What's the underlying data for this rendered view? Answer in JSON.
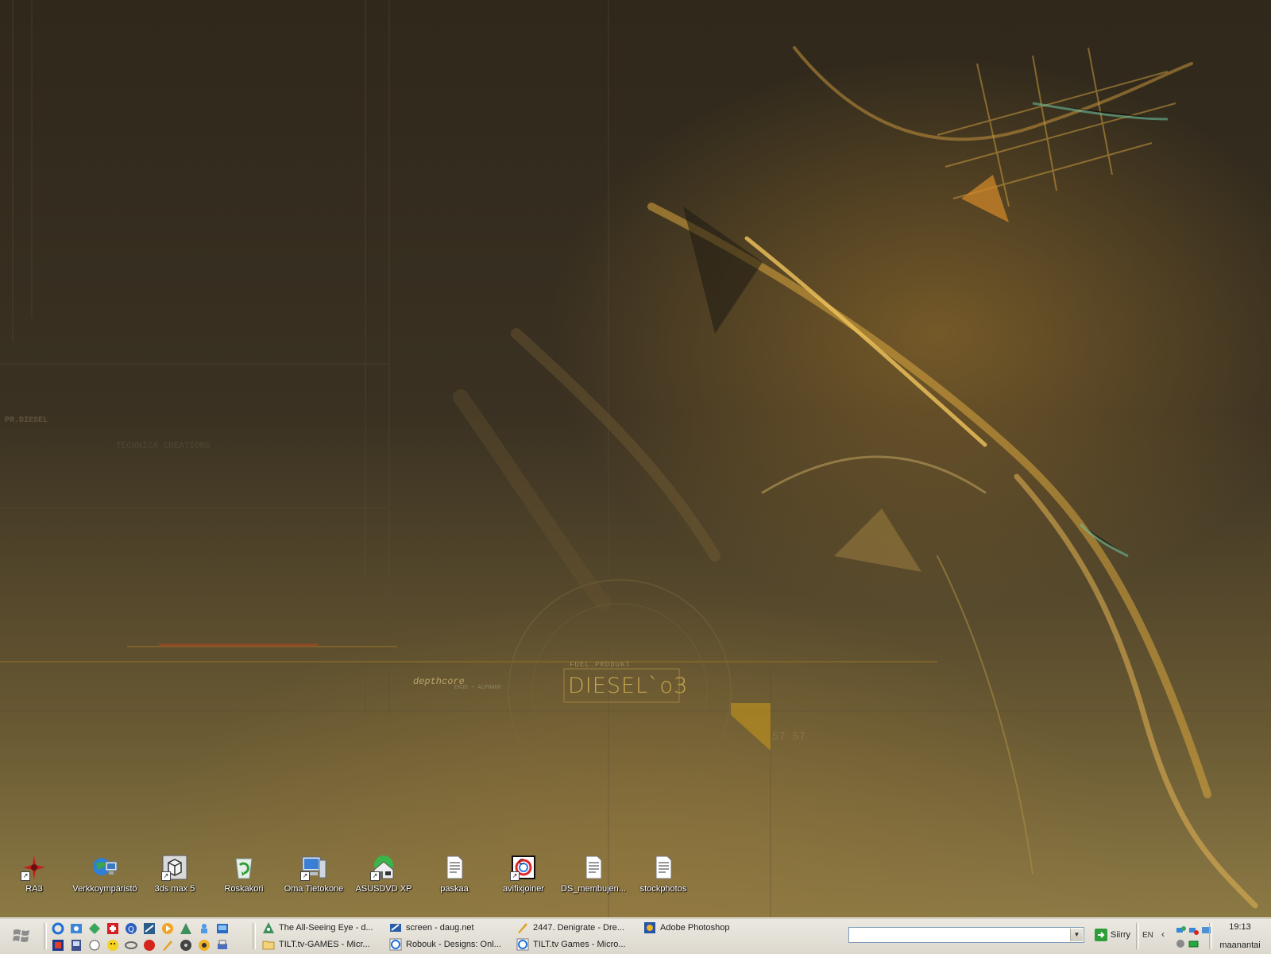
{
  "wallpaper": {
    "brand_title": "DIESEL`o3",
    "brand_fuel": "FUEL.PRODUKT",
    "brand_depth": "depthcore",
    "brand_sub": "EKUD + ALPHAKK",
    "brand_pr": "PR.DIESEL",
    "brand_tech": "TECHNICA CREATIONS",
    "brand_num": "57 57"
  },
  "desktop": {
    "icons": [
      {
        "label": "RA3",
        "icon": "ra3-game-icon"
      },
      {
        "label": "Verkkoympäristö",
        "icon": "network-places-icon"
      },
      {
        "label": "3ds max 5",
        "icon": "3dsmax-icon"
      },
      {
        "label": "Roskakori",
        "icon": "recycle-bin-icon"
      },
      {
        "label": "Oma Tietokone",
        "icon": "my-computer-icon"
      },
      {
        "label": "ASUSDVD XP",
        "icon": "asusdvd-icon"
      },
      {
        "label": "paskaa",
        "icon": "text-file-icon"
      },
      {
        "label": "avifixjoiner",
        "icon": "avifix-icon"
      },
      {
        "label": "DS_membujen...",
        "icon": "text-file-icon"
      },
      {
        "label": "stockphotos",
        "icon": "text-file-icon"
      }
    ]
  },
  "taskbar": {
    "tasks_row1": [
      {
        "label": "The All-Seeing Eye - d...",
        "icon": "all-seeing-eye-icon"
      },
      {
        "label": "screen - daug.net",
        "icon": "daug-icon"
      },
      {
        "label": "2447. Denigrate - Dre...",
        "icon": "dreamweaver-icon"
      },
      {
        "label": "Adobe Photoshop",
        "icon": "photoshop-icon"
      }
    ],
    "tasks_row2": [
      {
        "label": "TILT.tv-GAMES - Micr...",
        "icon": "folder-icon"
      },
      {
        "label": "Robouk - Designs: Onl...",
        "icon": "ie-icon"
      },
      {
        "label": "TILT.tv Games - Micro...",
        "icon": "ie-icon"
      }
    ],
    "address_value": "",
    "go_label": "Siirry",
    "language": "EN",
    "clock_time": "19:13",
    "clock_day": "maanantai",
    "colors": {
      "taskbar_bg": "#e6e2d8",
      "accent_gold": "#c9a94e"
    }
  }
}
